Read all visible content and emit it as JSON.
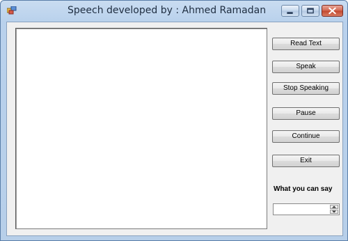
{
  "window": {
    "title": "Speech developed by : Ahmed Ramadan",
    "icon": "app-icon",
    "controls": {
      "minimize": "minimize-icon",
      "maximize": "maximize-icon",
      "close": "close-icon"
    }
  },
  "main": {
    "text_area": {
      "value": ""
    }
  },
  "buttons": {
    "read_text": "Read Text",
    "speak": "Speak",
    "stop_speaking": "Stop Speaking",
    "pause": "Pause",
    "continue": "Continue",
    "exit": "Exit"
  },
  "what_you_can_say": {
    "label": "What you can say",
    "value": ""
  },
  "colors": {
    "titlebar": "#b9d1ec",
    "client": "#f0f0f0",
    "close_button": "#c0452c"
  }
}
